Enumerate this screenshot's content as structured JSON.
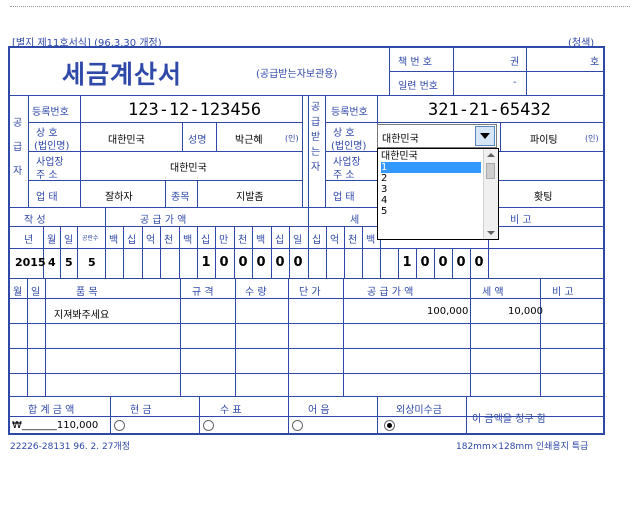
{
  "header": {
    "form_number": "[별지 제11호서식]  (96.3.30 개정)",
    "copy_color": "(청색)",
    "title": "세금계산서",
    "subtitle": "(공급받는자보관용)",
    "book_label": "책 번 호",
    "book_vol": "권",
    "book_no": "호",
    "serial_label": "일련 번호",
    "serial_sep": "-"
  },
  "supplier": {
    "side_label": "공급자",
    "reg_label": "등록번호",
    "reg_value": "123-12-123456",
    "name_label_1": "상    호",
    "name_label_2": "(법인명)",
    "name_value": "대한민국",
    "rep_label": "성명",
    "rep_value": "박근혜",
    "seal": "(인)",
    "addr_label_1": "사업장",
    "addr_label_2": "주   소",
    "addr_value": "대한민국",
    "type_label": "업   태",
    "type_value": "잘하자",
    "item_label": "종목",
    "item_value": "지발좀"
  },
  "receiver": {
    "side_label": "공급받는자",
    "reg_label": "등록번호",
    "reg_value": "321-21-65432",
    "name_label_1": "상    호",
    "name_label_2": "(법인명)",
    "name_select": "대한민국",
    "rep_value": "파이팅",
    "seal": "(인)",
    "addr_label_1": "사업장",
    "addr_label_2": "주   소",
    "type_label": "업   태",
    "item_value": "홧팅",
    "options": [
      "대한민국",
      "1",
      "2",
      "3",
      "4",
      "5"
    ],
    "selected_option": "1"
  },
  "amounts": {
    "date_header": "작      성",
    "supply_header": "공    급    가    액",
    "tax_header": "세",
    "note_header": "비      고",
    "col_year": "년",
    "col_month": "월",
    "col_day": "일",
    "col_blank": "공란수",
    "units": [
      "백",
      "십",
      "억",
      "천",
      "백",
      "십",
      "만",
      "천",
      "백",
      "십",
      "일"
    ],
    "tax_units": [
      "십",
      "억",
      "천",
      "백"
    ],
    "year": "2015",
    "month": "4",
    "day": "5",
    "blank": "5",
    "supply_digits": [
      "1",
      "0",
      "0",
      "0",
      "0",
      "0"
    ],
    "tax_digits": [
      "1",
      "0",
      "0",
      "0",
      "0"
    ]
  },
  "items": {
    "col_month": "월",
    "col_day": "일",
    "col_name": "품          목",
    "col_spec": "규  격",
    "col_qty": "수  량",
    "col_price": "단  가",
    "col_supply": "공  급  가  액",
    "col_tax": "세      액",
    "col_note": "비      고",
    "rows": [
      {
        "name": "지져봐주세요",
        "supply": "100,000",
        "tax": "10,000"
      }
    ]
  },
  "totals": {
    "total_label": "합  계  금  액",
    "cash_label": "현      금",
    "check_label": "수      표",
    "note_label": "어      음",
    "credit_label": "외상미수금",
    "total_value": "₩_______110,000",
    "claim_text": "이 금액을  청구  함",
    "selected": "credit"
  },
  "footer": {
    "left": "22226-28131 96. 2. 27개정",
    "right": "182mm×128mm 인쇄용지 특급"
  }
}
